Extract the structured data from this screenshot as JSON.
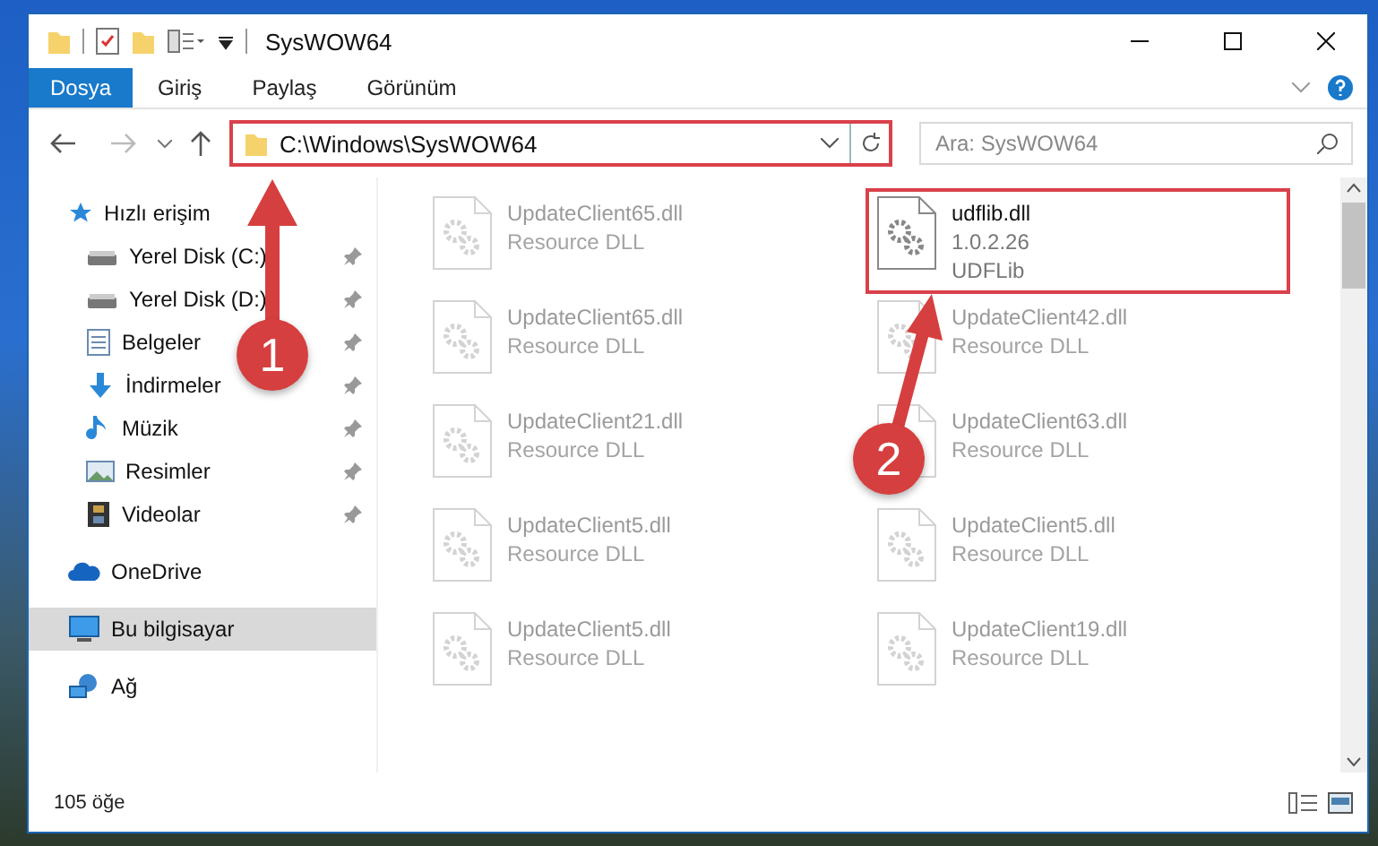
{
  "window": {
    "title": "SysWOW64"
  },
  "ribbon_tabs": [
    {
      "label": "Dosya",
      "selected": true
    },
    {
      "label": "Giriş",
      "selected": false
    },
    {
      "label": "Paylaş",
      "selected": false
    },
    {
      "label": "Görünüm",
      "selected": false
    }
  ],
  "address_bar": {
    "path": "C:\\Windows\\SysWOW64"
  },
  "search": {
    "placeholder": "Ara: SysWOW64"
  },
  "sidebar": {
    "items": [
      {
        "label": "Hızlı erişim",
        "selected": false,
        "children": [
          {
            "label": "Yerel Disk (C:)",
            "pinned": true
          },
          {
            "label": "Yerel Disk (D:)",
            "pinned": true
          },
          {
            "label": "Belgeler",
            "pinned": true
          },
          {
            "label": "İndirmeler",
            "pinned": true
          },
          {
            "label": "Müzik",
            "pinned": true
          },
          {
            "label": "Resimler",
            "pinned": true
          },
          {
            "label": "Videolar",
            "pinned": true
          }
        ]
      },
      {
        "label": "OneDrive",
        "selected": false
      },
      {
        "label": "Bu bilgisayar",
        "selected": true
      },
      {
        "label": "Ağ",
        "selected": false
      }
    ]
  },
  "files": [
    {
      "name": "UpdateClient65.dll",
      "lines": [
        "Resource DLL"
      ],
      "highlighted": false
    },
    {
      "name": "udflib.dll",
      "lines": [
        "1.0.2.26",
        "UDFLib"
      ],
      "highlighted": true
    },
    {
      "name": "UpdateClient65.dll",
      "lines": [
        "Resource DLL"
      ],
      "highlighted": false
    },
    {
      "name": "UpdateClient42.dll",
      "lines": [
        "Resource DLL"
      ],
      "highlighted": false
    },
    {
      "name": "UpdateClient21.dll",
      "lines": [
        "Resource DLL"
      ],
      "highlighted": false
    },
    {
      "name": "UpdateClient63.dll",
      "lines": [
        "Resource DLL"
      ],
      "highlighted": false
    },
    {
      "name": "UpdateClient5.dll",
      "lines": [
        "Resource DLL"
      ],
      "highlighted": false
    },
    {
      "name": "UpdateClient5.dll",
      "lines": [
        "Resource DLL"
      ],
      "highlighted": false
    },
    {
      "name": "UpdateClient5.dll",
      "lines": [
        "Resource DLL"
      ],
      "highlighted": false
    },
    {
      "name": "UpdateClient19.dll",
      "lines": [
        "Resource DLL"
      ],
      "highlighted": false
    }
  ],
  "status_bar": {
    "count": "105 öğe"
  },
  "annotations": [
    {
      "label": "1"
    },
    {
      "label": "2"
    }
  ]
}
